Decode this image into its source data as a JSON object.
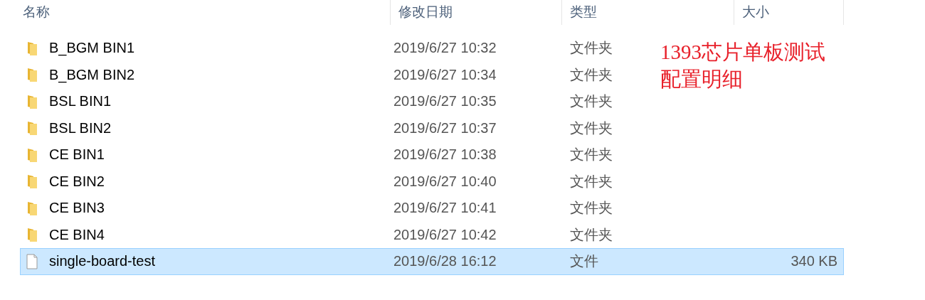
{
  "columns": [
    "名称",
    "修改日期",
    "类型",
    "大小"
  ],
  "rows": [
    {
      "kind": "folder",
      "name": "B_BGM BIN1",
      "modified": "2019/6/27 10:32",
      "type": "文件夹",
      "selected": false
    },
    {
      "kind": "folder",
      "name": "B_BGM BIN2",
      "modified": "2019/6/27 10:34",
      "type": "文件夹",
      "selected": false
    },
    {
      "kind": "folder",
      "name": "BSL BIN1",
      "modified": "2019/6/27 10:35",
      "type": "文件夹",
      "selected": false
    },
    {
      "kind": "folder",
      "name": "BSL BIN2",
      "modified": "2019/6/27 10:37",
      "type": "文件夹",
      "selected": false
    },
    {
      "kind": "folder",
      "name": "CE BIN1",
      "modified": "2019/6/27 10:38",
      "type": "文件夹",
      "selected": false
    },
    {
      "kind": "folder",
      "name": "CE BIN2",
      "modified": "2019/6/27 10:40",
      "type": "文件夹",
      "selected": false
    },
    {
      "kind": "folder",
      "name": "CE BIN3",
      "modified": "2019/6/27 10:41",
      "type": "文件夹",
      "selected": false
    },
    {
      "kind": "folder",
      "name": "CE BIN4",
      "modified": "2019/6/27 10:42",
      "type": "文件夹",
      "selected": false
    },
    {
      "kind": "file",
      "name": "single-board-test",
      "modified": "2019/6/28 16:12",
      "type": "文件",
      "size": "340 KB",
      "selected": true
    }
  ],
  "annotation": [
    "1393芯片单板测试",
    "配置明细"
  ]
}
